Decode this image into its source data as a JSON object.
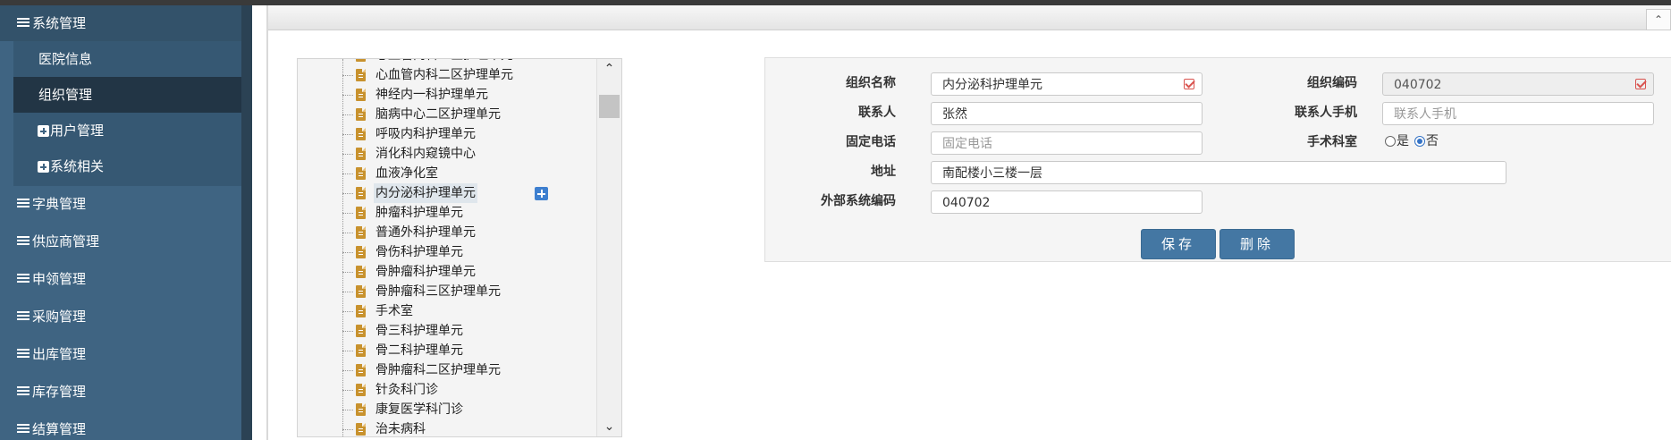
{
  "sidebar": {
    "system_management": "系统管理",
    "sub_items": {
      "hospital_info": "医院信息",
      "org_management": "组织管理",
      "user_management": "用户管理",
      "system_related": "系统相关"
    },
    "dictionary": "字典管理",
    "supplier": "供应商管理",
    "requisition": "申领管理",
    "purchase": "采购管理",
    "outbound": "出库管理",
    "inventory": "库存管理",
    "settlement": "结算管理"
  },
  "tree": {
    "nodes": [
      "心血管内科一区护理单元",
      "心血管内科二区护理单元",
      "神经内一科护理单元",
      "脑病中心二区护理单元",
      "呼吸内科护理单元",
      "消化科内窥镜中心",
      "血液净化室",
      "内分泌科护理单元",
      "肿瘤科护理单元",
      "普通外科护理单元",
      "骨伤科护理单元",
      "骨肿瘤科护理单元",
      "骨肿瘤科三区护理单元",
      "手术室",
      "骨三科护理单元",
      "骨二科护理单元",
      "骨肿瘤科二区护理单元",
      "针灸科门诊",
      "康复医学科门诊",
      "治未病科"
    ],
    "selected_index": 7
  },
  "form": {
    "org_name_label": "组织名称",
    "org_name_value": "内分泌科护理单元",
    "org_code_label": "组织编码",
    "org_code_value": "040702",
    "contact_label": "联系人",
    "contact_value": "张然",
    "contact_phone_label": "联系人手机",
    "contact_phone_placeholder": "联系人手机",
    "fixed_phone_label": "固定电话",
    "fixed_phone_placeholder": "固定电话",
    "surgery_dept_label": "手术科室",
    "surgery_yes": "是",
    "surgery_no": "否",
    "surgery_selected": "否",
    "address_label": "地址",
    "address_value": "南配楼小三楼一层",
    "external_code_label": "外部系统编码",
    "external_code_value": "040702",
    "save_button": "保存",
    "delete_button": "删除"
  },
  "colors": {
    "sidebar_bg": "#3f6482",
    "sidebar_selected": "#223545",
    "button_bg": "#4477a3",
    "required_mark": "#d9534f"
  }
}
